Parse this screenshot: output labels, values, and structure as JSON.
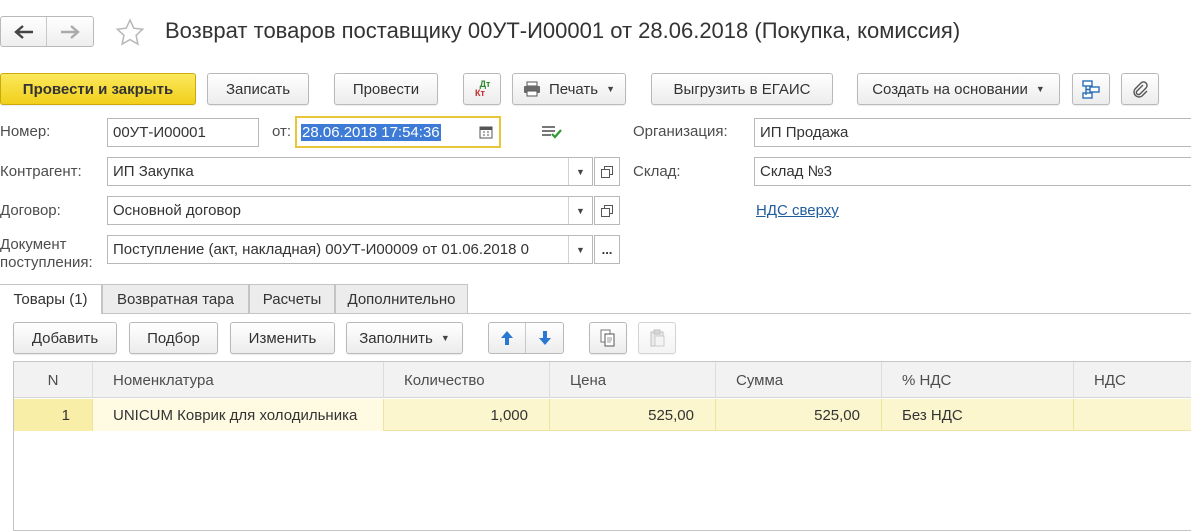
{
  "window": {
    "title": "Возврат товаров поставщику 00УТ-И00001 от 28.06.2018 (Покупка, комиссия)"
  },
  "toolbar": {
    "post_close": "Провести и закрыть",
    "save": "Записать",
    "post": "Провести",
    "dtkt_top": "Дт",
    "dtkt_bottom": "Кт",
    "print": "Печать",
    "egais": "Выгрузить в ЕГАИС",
    "create_based": "Создать на основании"
  },
  "form": {
    "number_label": "Номер:",
    "number_value": "00УТ-И00001",
    "date_label": "от:",
    "date_value": "28.06.2018 17:54:36",
    "org_label": "Организация:",
    "org_value": "ИП Продажа",
    "contractor_label": "Контрагент:",
    "contractor_value": "ИП Закупка",
    "warehouse_label": "Склад:",
    "warehouse_value": "Склад №3",
    "contract_label": "Договор:",
    "contract_value": "Основной договор",
    "vat_link": "НДС сверху",
    "receipt_label_line1": "Документ",
    "receipt_label_line2": "поступления:",
    "receipt_value": "Поступление (акт, накладная) 00УТ-И00009 от 01.06.2018 0",
    "receipt_more": "..."
  },
  "tabs": [
    {
      "label": "Товары (1)",
      "active": true
    },
    {
      "label": "Возвратная тара",
      "active": false
    },
    {
      "label": "Расчеты",
      "active": false
    },
    {
      "label": "Дополнительно",
      "active": false
    }
  ],
  "table_toolbar": {
    "add": "Добавить",
    "pick": "Подбор",
    "edit": "Изменить",
    "fill": "Заполнить"
  },
  "table": {
    "columns": [
      "N",
      "Номенклатура",
      "Количество",
      "Цена",
      "Сумма",
      "% НДС",
      "НДС"
    ],
    "rows": [
      {
        "n": "1",
        "item": "UNICUM Коврик для холодильника",
        "qty": "1,000",
        "price": "525,00",
        "sum": "525,00",
        "vat_rate": "Без НДС",
        "vat": ""
      }
    ]
  },
  "colors": {
    "primary_button": "#f1cf1a",
    "selected_row": "#fbf6cd",
    "link": "#1f5d9c",
    "arrow_blue": "#2a78d4"
  }
}
